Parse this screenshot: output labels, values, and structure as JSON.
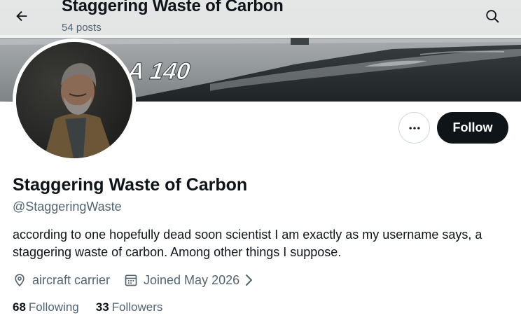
{
  "header": {
    "title": "Staggering Waste of Carbon",
    "post_count": "54 posts",
    "back_icon": "arrow-left-icon",
    "search_icon": "search-icon"
  },
  "banner": {
    "description_text": "A 140"
  },
  "actions": {
    "more_icon": "more-horizontal-icon",
    "follow_label": "Follow"
  },
  "profile": {
    "display_name": "Staggering Waste of Carbon",
    "handle": "@StaggeringWaste",
    "bio": "according to one hopefully dead soon scientist I am exactly as my username says, a staggering waste of carbon. Among other things I suppose.",
    "location": "aircraft carrier",
    "joined": "Joined May 2026"
  },
  "stats": {
    "following_count": "68",
    "following_label": "Following",
    "followers_count": "33",
    "followers_label": "Followers"
  },
  "colors": {
    "text_primary": "#0f1419",
    "text_secondary": "#536471",
    "follow_bg": "#0f1419",
    "border": "#cfd9de"
  }
}
